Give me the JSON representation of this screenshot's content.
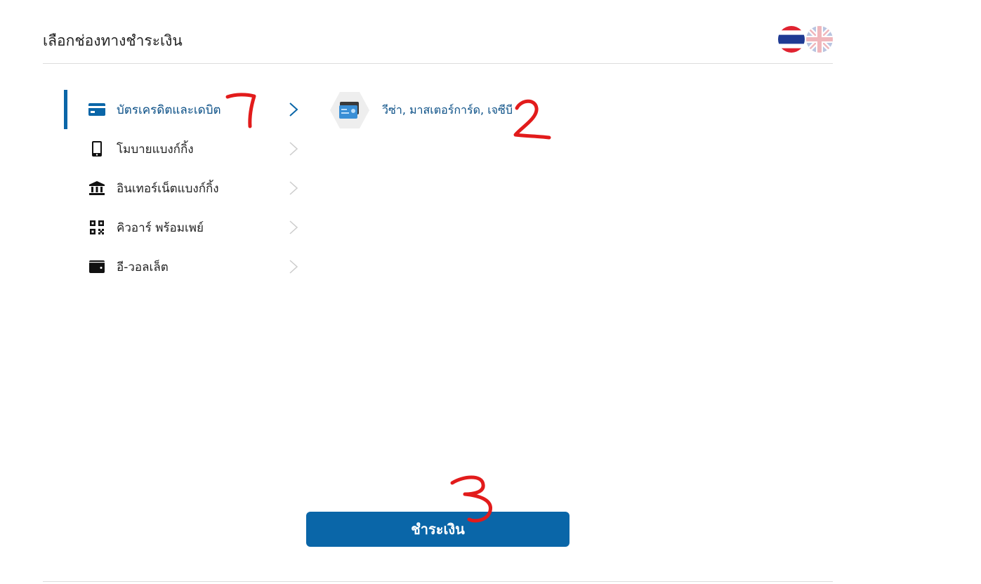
{
  "header": {
    "title": "เลือกช่องทางชำระเงิน",
    "languages": [
      {
        "code": "th",
        "icon": "thai-flag-icon",
        "active": true
      },
      {
        "code": "en",
        "icon": "uk-flag-icon",
        "active": false
      }
    ]
  },
  "payment_methods": [
    {
      "label": "บัตรเครดิตและเดบิต",
      "icon": "credit-card-icon",
      "active": true
    },
    {
      "label": "โมบายแบงก์กิ้ง",
      "icon": "mobile-phone-icon",
      "active": false
    },
    {
      "label": "อินเทอร์เน็ตแบงก์กิ้ง",
      "icon": "bank-icon",
      "active": false
    },
    {
      "label": "คิวอาร์ พร้อมเพย์",
      "icon": "qr-code-icon",
      "active": false
    },
    {
      "label": "อี-วอลเล็ต",
      "icon": "wallet-icon",
      "active": false
    }
  ],
  "selected_option": {
    "label": "วีซ่า, มาสเตอร์การ์ด, เจซีบี",
    "icon": "card-hexagon-icon"
  },
  "pay_button": {
    "label": "ชำระเงิน"
  },
  "colors": {
    "accent": "#0a66a8",
    "accent_text": "#0a4f86",
    "annotation": "#e21b1b",
    "divider": "#dcdcdc"
  },
  "annotations": [
    "1",
    "2",
    "3"
  ]
}
